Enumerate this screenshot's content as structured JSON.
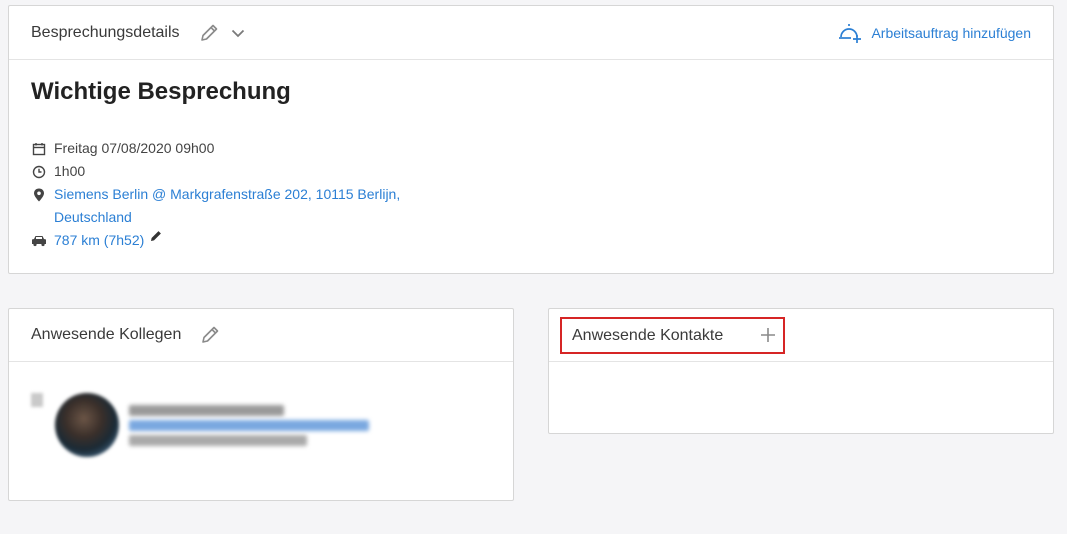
{
  "details": {
    "header_title": "Besprechungsdetails",
    "action_label": "Arbeitsauftrag hinzufügen",
    "meeting_title": "Wichtige Besprechung",
    "date": "Freitag 07/08/2020 09h00",
    "duration": "1h00",
    "location_line1": "Siemens Berlin @ Markgrafenstraße 202, 10115 Berlijn,",
    "location_line2": "Deutschland",
    "distance": "787 km (7h52)"
  },
  "colleagues": {
    "header_title": "Anwesende Kollegen"
  },
  "contacts": {
    "header_title": "Anwesende Kontakte"
  },
  "colors": {
    "accent": "#2b7fd4",
    "highlight": "#d62525"
  },
  "icons": [
    "pencil-icon",
    "chevron-down-icon",
    "add-work-order-icon",
    "calendar-icon",
    "clock-icon",
    "location-pin-icon",
    "car-icon",
    "plus-icon"
  ]
}
